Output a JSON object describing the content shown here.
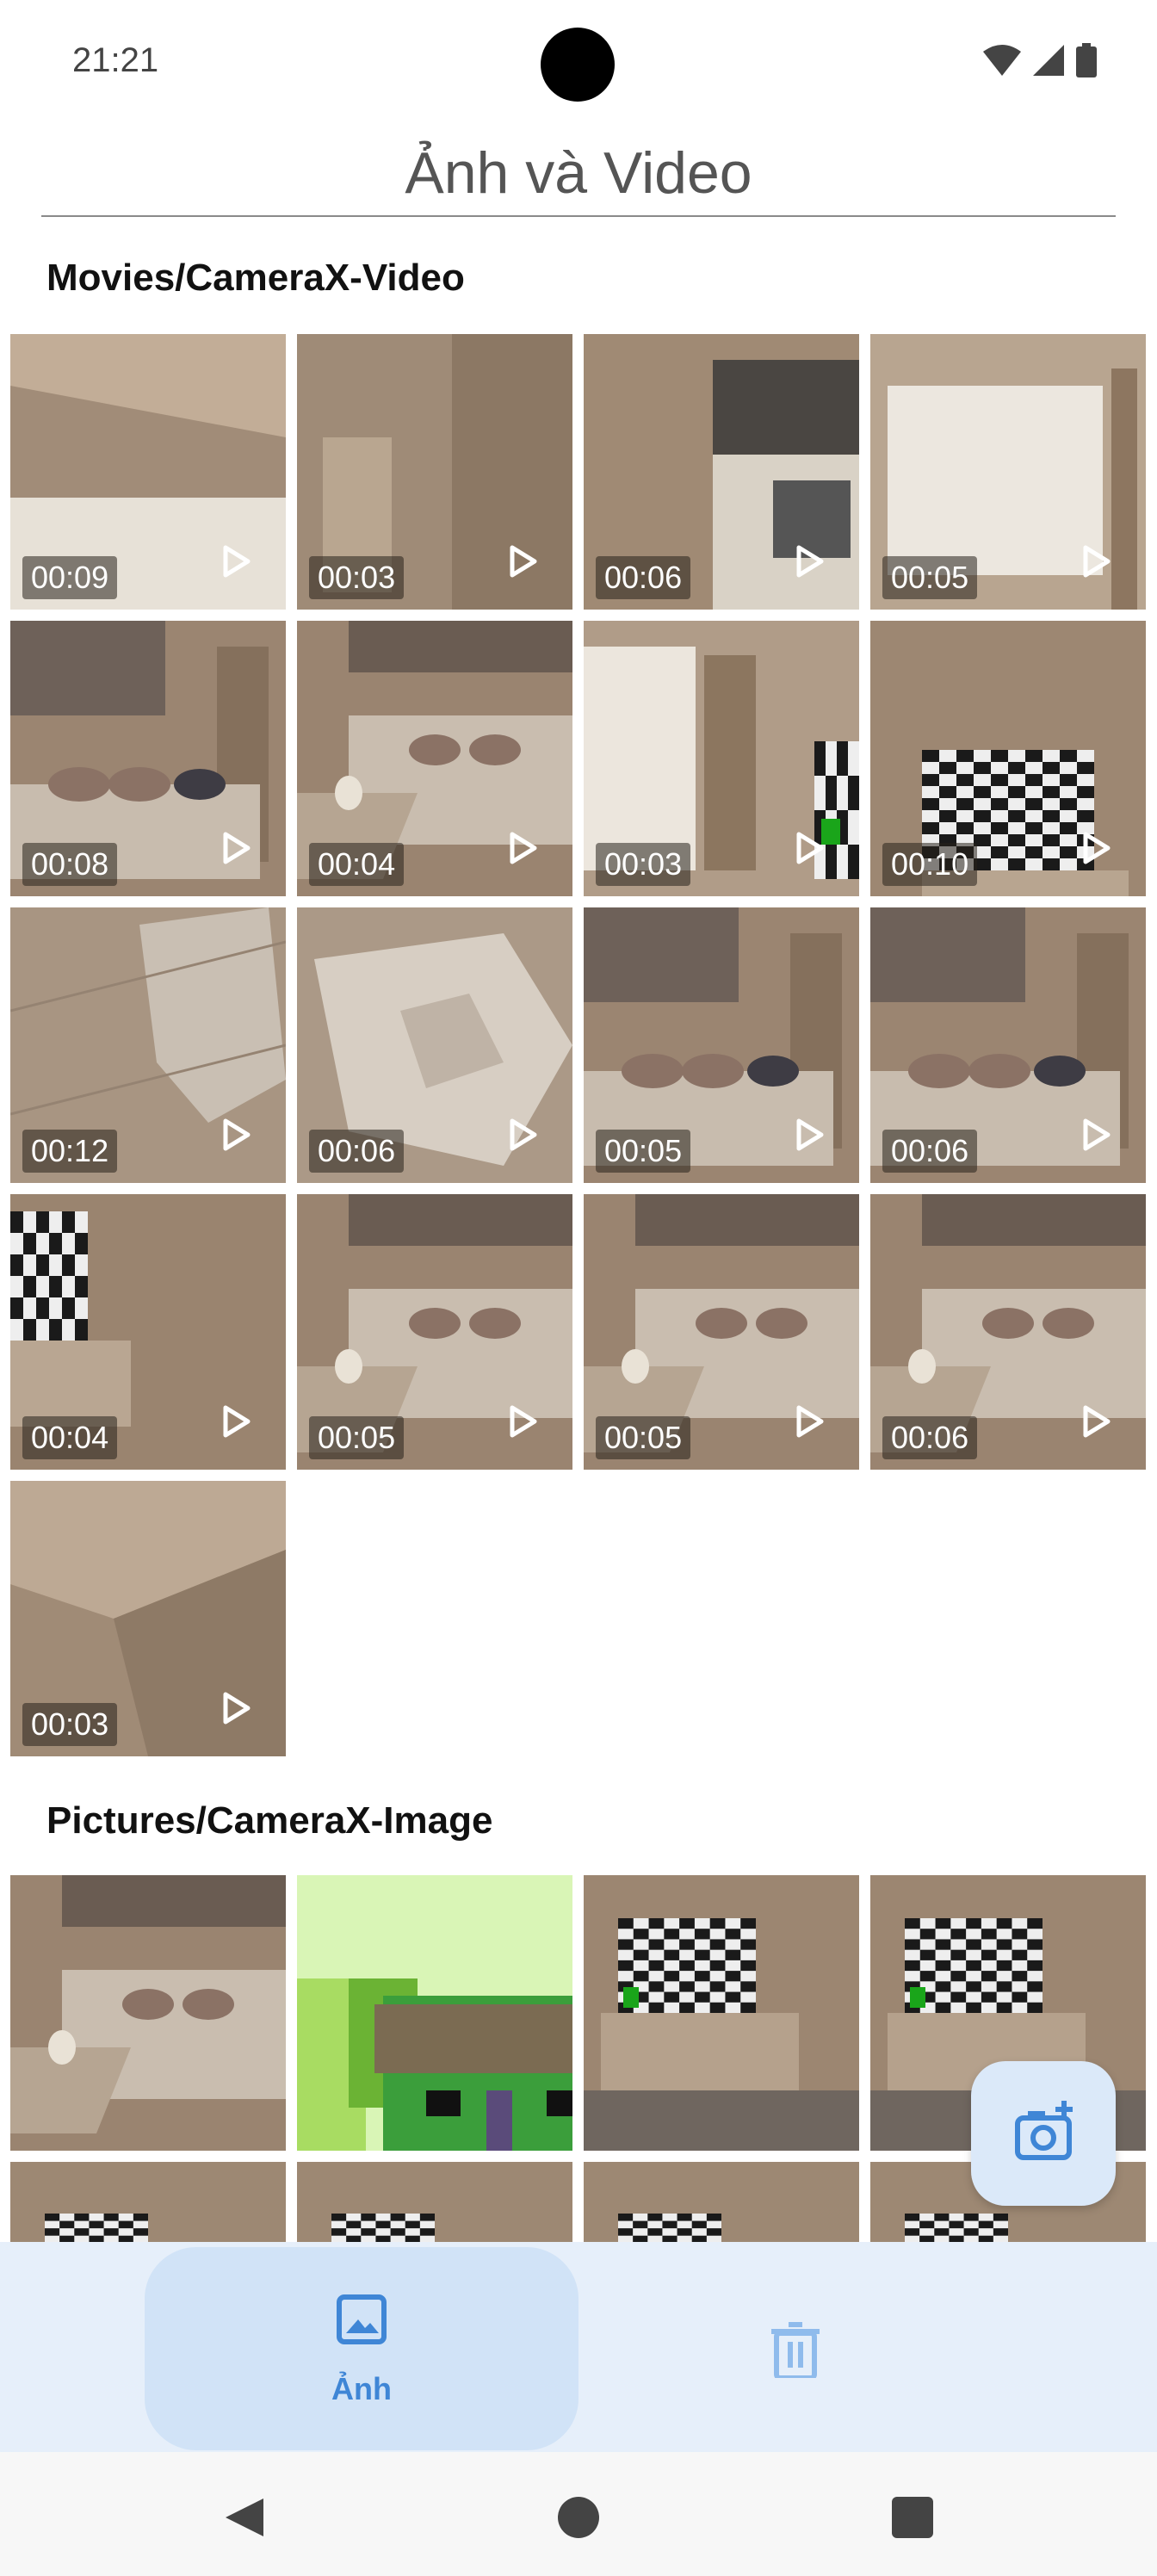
{
  "status": {
    "time": "21:21"
  },
  "header": {
    "title": "Ảnh và Video"
  },
  "sections": {
    "videos": {
      "heading": "Movies/CameraX-Video",
      "items": [
        {
          "duration": "00:09",
          "thumb": "ceiling-window"
        },
        {
          "duration": "00:03",
          "thumb": "doorway"
        },
        {
          "duration": "00:06",
          "thumb": "kitchen"
        },
        {
          "duration": "00:05",
          "thumb": "bright-window"
        },
        {
          "duration": "00:08",
          "thumb": "living-room-sofa"
        },
        {
          "duration": "00:04",
          "thumb": "sofa-cup"
        },
        {
          "duration": "00:03",
          "thumb": "window-shelf-tv"
        },
        {
          "duration": "00:10",
          "thumb": "tv-checker"
        },
        {
          "duration": "00:12",
          "thumb": "floor-dog"
        },
        {
          "duration": "00:06",
          "thumb": "dog-closeup"
        },
        {
          "duration": "00:05",
          "thumb": "living-room-sofa"
        },
        {
          "duration": "00:06",
          "thumb": "living-room-sofa"
        },
        {
          "duration": "00:04",
          "thumb": "tv-checker-side"
        },
        {
          "duration": "00:05",
          "thumb": "sofa-cup"
        },
        {
          "duration": "00:05",
          "thumb": "sofa-cup"
        },
        {
          "duration": "00:06",
          "thumb": "sofa-cup"
        },
        {
          "duration": "00:03",
          "thumb": "ceiling-corner"
        }
      ]
    },
    "images": {
      "heading": "Pictures/CameraX-Image",
      "items": [
        {
          "thumb": "sofa-cup"
        },
        {
          "thumb": "pixel-art"
        },
        {
          "thumb": "tv-cabinet"
        },
        {
          "thumb": "tv-cabinet"
        },
        {
          "thumb": "tv-checker-partial"
        },
        {
          "thumb": "tv-checker-partial"
        },
        {
          "thumb": "tv-checker-partial"
        },
        {
          "thumb": "tv-checker-partial"
        }
      ]
    }
  },
  "fab": {
    "icon": "add-camera-icon"
  },
  "bottom_nav": {
    "items": [
      {
        "label": "Ảnh",
        "icon": "image-icon",
        "active": true
      },
      {
        "label": "",
        "icon": "trash-icon",
        "active": false
      }
    ]
  },
  "system_nav": {
    "icons": [
      "back-icon",
      "home-icon",
      "recents-icon"
    ]
  },
  "colors": {
    "accent": "#3f86d6",
    "nav_bg": "#e6effa",
    "nav_active": "#d1e3f7",
    "fab_bg": "#dbe9f9"
  }
}
